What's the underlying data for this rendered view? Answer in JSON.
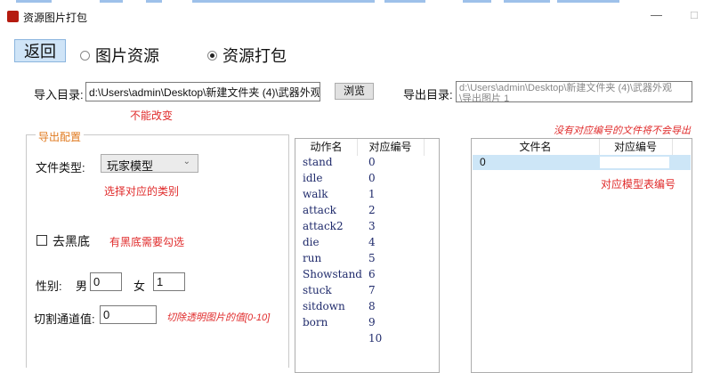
{
  "window": {
    "title": "资源图片打包",
    "minimize": "—",
    "maximize": "□"
  },
  "nav": {
    "back": "返回",
    "radio_images": "图片资源",
    "radio_pack": "资源打包",
    "selected": "资源打包"
  },
  "import": {
    "label": "导入目录:",
    "value": "d:\\Users\\admin\\Desktop\\新建文件夹 (4)\\武器外观",
    "browse": "浏览",
    "note": "不能改变"
  },
  "export": {
    "label": "导出目录:",
    "value_line1": "d:\\Users\\admin\\Desktop\\新建文件夹 (4)\\武器外观",
    "value_line2": "\\导出图片 1",
    "note": "没有对应编号的文件将不会导出"
  },
  "config": {
    "group_title": "导出配置",
    "file_type_label": "文件类型:",
    "file_type_value": "玩家模型",
    "file_type_note": "选择对应的类别",
    "remove_black_label": "去黑底",
    "remove_black_note": "有黑底需要勾选",
    "gender_label": "性别:",
    "male_label": "男",
    "male_value": "0",
    "female_label": "女",
    "female_value": "1",
    "threshold_label": "切割通道值:",
    "threshold_value": "0",
    "threshold_note": "切除透明图片的值[0-10]"
  },
  "actions_table": {
    "headers": [
      "动作名",
      "对应编号"
    ],
    "rows": [
      [
        "stand",
        "0"
      ],
      [
        "idle",
        "0"
      ],
      [
        "walk",
        "1"
      ],
      [
        "attack",
        "2"
      ],
      [
        "attack2",
        "3"
      ],
      [
        "die",
        "4"
      ],
      [
        "run",
        "5"
      ],
      [
        "Showstand",
        "6"
      ],
      [
        "stuck",
        "7"
      ],
      [
        "sitdown",
        "8"
      ],
      [
        "born",
        "9"
      ],
      [
        "",
        "10"
      ]
    ]
  },
  "files_table": {
    "headers": [
      "文件名",
      "对应编号"
    ],
    "rows": [
      [
        "0",
        ""
      ]
    ],
    "note": "对应模型表编号"
  },
  "colors": {
    "accent": "#e07a1f",
    "warning": "#e02b2b",
    "selection": "#cde6f7",
    "button_blue": "#cfe4f7"
  }
}
